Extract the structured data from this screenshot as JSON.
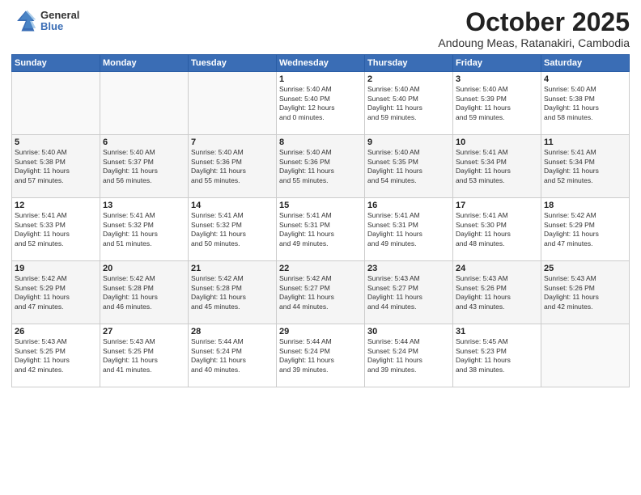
{
  "logo": {
    "general": "General",
    "blue": "Blue"
  },
  "header": {
    "month": "October 2025",
    "location": "Andoung Meas, Ratanakiri, Cambodia"
  },
  "days_of_week": [
    "Sunday",
    "Monday",
    "Tuesday",
    "Wednesday",
    "Thursday",
    "Friday",
    "Saturday"
  ],
  "weeks": [
    [
      {
        "day": "",
        "info": ""
      },
      {
        "day": "",
        "info": ""
      },
      {
        "day": "",
        "info": ""
      },
      {
        "day": "1",
        "info": "Sunrise: 5:40 AM\nSunset: 5:40 PM\nDaylight: 12 hours\nand 0 minutes."
      },
      {
        "day": "2",
        "info": "Sunrise: 5:40 AM\nSunset: 5:40 PM\nDaylight: 11 hours\nand 59 minutes."
      },
      {
        "day": "3",
        "info": "Sunrise: 5:40 AM\nSunset: 5:39 PM\nDaylight: 11 hours\nand 59 minutes."
      },
      {
        "day": "4",
        "info": "Sunrise: 5:40 AM\nSunset: 5:38 PM\nDaylight: 11 hours\nand 58 minutes."
      }
    ],
    [
      {
        "day": "5",
        "info": "Sunrise: 5:40 AM\nSunset: 5:38 PM\nDaylight: 11 hours\nand 57 minutes."
      },
      {
        "day": "6",
        "info": "Sunrise: 5:40 AM\nSunset: 5:37 PM\nDaylight: 11 hours\nand 56 minutes."
      },
      {
        "day": "7",
        "info": "Sunrise: 5:40 AM\nSunset: 5:36 PM\nDaylight: 11 hours\nand 55 minutes."
      },
      {
        "day": "8",
        "info": "Sunrise: 5:40 AM\nSunset: 5:36 PM\nDaylight: 11 hours\nand 55 minutes."
      },
      {
        "day": "9",
        "info": "Sunrise: 5:40 AM\nSunset: 5:35 PM\nDaylight: 11 hours\nand 54 minutes."
      },
      {
        "day": "10",
        "info": "Sunrise: 5:41 AM\nSunset: 5:34 PM\nDaylight: 11 hours\nand 53 minutes."
      },
      {
        "day": "11",
        "info": "Sunrise: 5:41 AM\nSunset: 5:34 PM\nDaylight: 11 hours\nand 52 minutes."
      }
    ],
    [
      {
        "day": "12",
        "info": "Sunrise: 5:41 AM\nSunset: 5:33 PM\nDaylight: 11 hours\nand 52 minutes."
      },
      {
        "day": "13",
        "info": "Sunrise: 5:41 AM\nSunset: 5:32 PM\nDaylight: 11 hours\nand 51 minutes."
      },
      {
        "day": "14",
        "info": "Sunrise: 5:41 AM\nSunset: 5:32 PM\nDaylight: 11 hours\nand 50 minutes."
      },
      {
        "day": "15",
        "info": "Sunrise: 5:41 AM\nSunset: 5:31 PM\nDaylight: 11 hours\nand 49 minutes."
      },
      {
        "day": "16",
        "info": "Sunrise: 5:41 AM\nSunset: 5:31 PM\nDaylight: 11 hours\nand 49 minutes."
      },
      {
        "day": "17",
        "info": "Sunrise: 5:41 AM\nSunset: 5:30 PM\nDaylight: 11 hours\nand 48 minutes."
      },
      {
        "day": "18",
        "info": "Sunrise: 5:42 AM\nSunset: 5:29 PM\nDaylight: 11 hours\nand 47 minutes."
      }
    ],
    [
      {
        "day": "19",
        "info": "Sunrise: 5:42 AM\nSunset: 5:29 PM\nDaylight: 11 hours\nand 47 minutes."
      },
      {
        "day": "20",
        "info": "Sunrise: 5:42 AM\nSunset: 5:28 PM\nDaylight: 11 hours\nand 46 minutes."
      },
      {
        "day": "21",
        "info": "Sunrise: 5:42 AM\nSunset: 5:28 PM\nDaylight: 11 hours\nand 45 minutes."
      },
      {
        "day": "22",
        "info": "Sunrise: 5:42 AM\nSunset: 5:27 PM\nDaylight: 11 hours\nand 44 minutes."
      },
      {
        "day": "23",
        "info": "Sunrise: 5:43 AM\nSunset: 5:27 PM\nDaylight: 11 hours\nand 44 minutes."
      },
      {
        "day": "24",
        "info": "Sunrise: 5:43 AM\nSunset: 5:26 PM\nDaylight: 11 hours\nand 43 minutes."
      },
      {
        "day": "25",
        "info": "Sunrise: 5:43 AM\nSunset: 5:26 PM\nDaylight: 11 hours\nand 42 minutes."
      }
    ],
    [
      {
        "day": "26",
        "info": "Sunrise: 5:43 AM\nSunset: 5:25 PM\nDaylight: 11 hours\nand 42 minutes."
      },
      {
        "day": "27",
        "info": "Sunrise: 5:43 AM\nSunset: 5:25 PM\nDaylight: 11 hours\nand 41 minutes."
      },
      {
        "day": "28",
        "info": "Sunrise: 5:44 AM\nSunset: 5:24 PM\nDaylight: 11 hours\nand 40 minutes."
      },
      {
        "day": "29",
        "info": "Sunrise: 5:44 AM\nSunset: 5:24 PM\nDaylight: 11 hours\nand 39 minutes."
      },
      {
        "day": "30",
        "info": "Sunrise: 5:44 AM\nSunset: 5:24 PM\nDaylight: 11 hours\nand 39 minutes."
      },
      {
        "day": "31",
        "info": "Sunrise: 5:45 AM\nSunset: 5:23 PM\nDaylight: 11 hours\nand 38 minutes."
      },
      {
        "day": "",
        "info": ""
      }
    ]
  ]
}
